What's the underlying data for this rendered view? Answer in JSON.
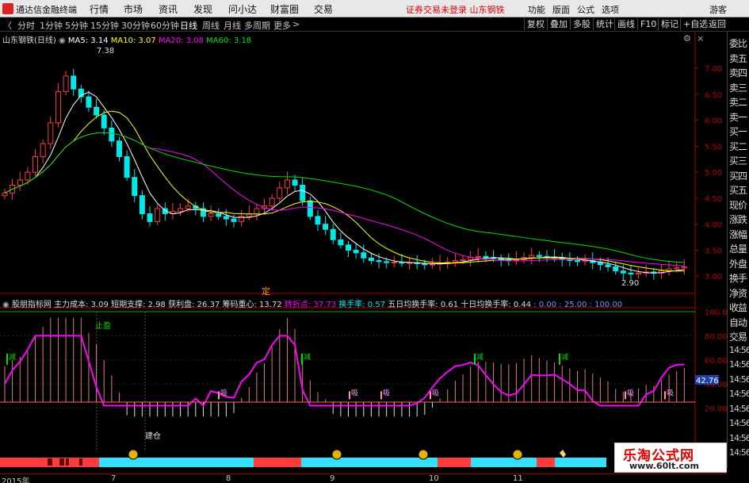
{
  "window": {
    "app_title": "通达信金融终端",
    "menus": [
      "行情",
      "市场",
      "资讯",
      "发现",
      "问小达",
      "财富圈",
      "交易"
    ],
    "notice": "证券交易未登录  山东钢铁",
    "right_menus": [
      "功能",
      "版面",
      "公式",
      "选项",
      "游客"
    ]
  },
  "periods": {
    "items": [
      "分时",
      "1分钟",
      "5分钟",
      "15分钟",
      "30分钟",
      "60分钟",
      "日线",
      "周线",
      "月线",
      "多周期",
      "更多"
    ],
    "active": "日线"
  },
  "right_buttons": [
    "复权",
    "叠加",
    "多股",
    "统计",
    "画线",
    "F10",
    "标记",
    "+自选",
    "返回"
  ],
  "main": {
    "legend": {
      "name": "山东钢铁(日线)",
      "ma5": "MA5: 3.14",
      "ma10": "MA10: 3.07",
      "ma20": "MA20: 3.08",
      "ma60": "MA60: 3.18"
    },
    "high_label": "7.38",
    "low_label": "2.90",
    "ding_label": "定",
    "yticks": [
      "7.00",
      "6.50",
      "6.00",
      "5.50",
      "5.00",
      "4.50",
      "4.00",
      "3.50",
      "3.00"
    ],
    "ylim": [
      2.82,
      7.55
    ]
  },
  "indicator": {
    "name": "股朋指标网",
    "cost": "主力成本: 3.09",
    "support": "短期支撑: 2.98",
    "profit": "获利盘: 26.37",
    "center": "筹码重心: 13.72",
    "turn": "转折点: 37.73",
    "hsl": "换手率: 0.57",
    "hsl5": "五日均换手率: 0.61",
    "hsl10": "十日均换手率: 0.44",
    "vals": ": 0.00 : 25.00 : 100.00",
    "yticks": [
      "100.0",
      "80.00",
      "60.00",
      "40.00",
      "20.00"
    ],
    "current": "42.76",
    "labels": {
      "zhiying": "止盈",
      "jiancang": "建仓",
      "jian": "减",
      "xi": "吸"
    }
  },
  "right_panel": [
    "委比",
    "卖五",
    "卖四",
    "卖三",
    "卖二",
    "卖一",
    "买一",
    "买二",
    "买三",
    "买四",
    "买五",
    "现价",
    "涨跌",
    "涨幅",
    "总量",
    "外盘",
    "换手",
    "净资",
    "收益",
    "自动",
    "交易",
    "14:56",
    "14:56",
    "14:56",
    "14:56",
    "14:56",
    "14:56",
    "14:56",
    "14:56"
  ],
  "dates": [
    "2015年",
    "7",
    "8",
    "9",
    "10",
    "11"
  ],
  "watermark": {
    "line1": "乐淘公式网",
    "line2": "www.60lt.com"
  },
  "colors": {
    "up": "#ff3c3c",
    "down": "#00e8e8",
    "ma5": "#ffffff",
    "ma10": "#ffff00",
    "ma20": "#ff00ff",
    "ma60": "#00e000",
    "axis": "#b00000"
  },
  "chart_data": {
    "type": "candlestick",
    "close": [
      4.6,
      4.75,
      4.85,
      5,
      5.3,
      5.55,
      5.95,
      6.55,
      6.85,
      6.6,
      6.45,
      6.25,
      6.1,
      5.85,
      5.6,
      5.3,
      4.9,
      4.55,
      4.2,
      4.05,
      4.3,
      4.2,
      4.25,
      4.3,
      4.35,
      4.3,
      4.15,
      4.2,
      4.15,
      4.1,
      4.05,
      4.15,
      4.2,
      4.3,
      4.35,
      4.5,
      4.7,
      4.85,
      4.75,
      4.45,
      4.15,
      4,
      3.9,
      3.7,
      3.6,
      3.5,
      3.45,
      3.35,
      3.3,
      3.28,
      3.26,
      3.27,
      3.25,
      3.26,
      3.24,
      3.22,
      3.23,
      3.25,
      3.27,
      3.3,
      3.32,
      3.36,
      3.38,
      3.36,
      3.34,
      3.32,
      3.31,
      3.32,
      3.36,
      3.4,
      3.38,
      3.36,
      3.35,
      3.32,
      3.3,
      3.28,
      3.3,
      3.26,
      3.22,
      3.18,
      3.1,
      3.06,
      3.04,
      3.06,
      3.08,
      3.06,
      3.1,
      3.14,
      3.16,
      3.18
    ]
  }
}
